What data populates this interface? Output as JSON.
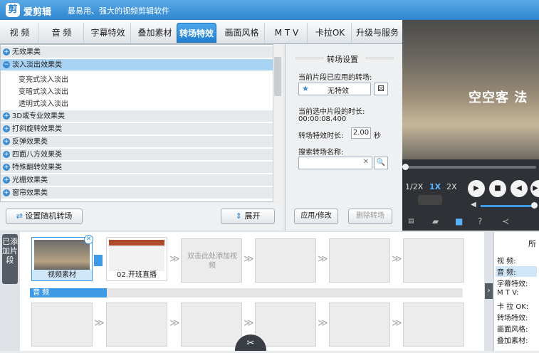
{
  "app": {
    "name": "爱剪辑",
    "slogan": "最易用、强大的视频剪辑软件",
    "logo_glyph": "剪"
  },
  "tabs": [
    "视 频",
    "音 频",
    "字幕特效",
    "叠加素材",
    "转场特效",
    "画面风格",
    "M T V",
    "卡拉OK",
    "升级与服务"
  ],
  "effect_list": {
    "categories": [
      {
        "label": "无效果类",
        "toggle": "+"
      },
      {
        "label": "淡入淡出效果类",
        "toggle": "−"
      },
      {
        "label": "3D或专业效果类",
        "toggle": "+"
      },
      {
        "label": "打斜旋转效果类",
        "toggle": "+"
      },
      {
        "label": "反弹效果类",
        "toggle": "+"
      },
      {
        "label": "四面八方效果类",
        "toggle": "+"
      },
      {
        "label": "特殊翻转效果类",
        "toggle": "+"
      },
      {
        "label": "光栅效果类",
        "toggle": "+"
      },
      {
        "label": "窗帘效果类",
        "toggle": "+"
      }
    ],
    "sub_items": [
      "变亮式淡入淡出",
      "变暗式淡入淡出",
      "透明式淡入淡出"
    ]
  },
  "buttons": {
    "random": "设置随机转场",
    "expand": "展开",
    "apply": "应用/修改",
    "delete": "删除转场"
  },
  "settings": {
    "title": "转场设置",
    "applied_label": "当前片段已应用的转场:",
    "applied_value": "无特效",
    "duration_label": "当前选中片段的时长:",
    "duration_value": "00:00:08.400",
    "effect_duration_label": "转场特效时长:",
    "effect_duration_value": "2.00",
    "effect_duration_unit": "秒",
    "search_label": "搜索转场名称:",
    "search_placeholder": "",
    "clear_glyph": "✕",
    "search_glyph": "🔍"
  },
  "preview": {
    "overlay_text": "空空客 法",
    "speeds": [
      "1/2X",
      "1X",
      "2X"
    ],
    "controls": [
      "▶",
      "■",
      "◀",
      "▶"
    ],
    "volume_glyph": "◀"
  },
  "timeline": {
    "side_label": "已添加片段",
    "clips": [
      {
        "caption": "视频素材"
      },
      {
        "caption": "02.开班直播"
      }
    ],
    "empty_slot_text": "双击此处添加视频",
    "audio_label": "音 频",
    "arrow_glyph": "≫",
    "collapse_glyph": "›"
  },
  "info_panel": {
    "header": "所",
    "rows": [
      "视    频:",
      "音    频:",
      "字幕特效:",
      "M  T  V:",
      "卡 拉 OK:",
      "转场特效:",
      "画面风格:",
      "叠加素材:"
    ]
  }
}
